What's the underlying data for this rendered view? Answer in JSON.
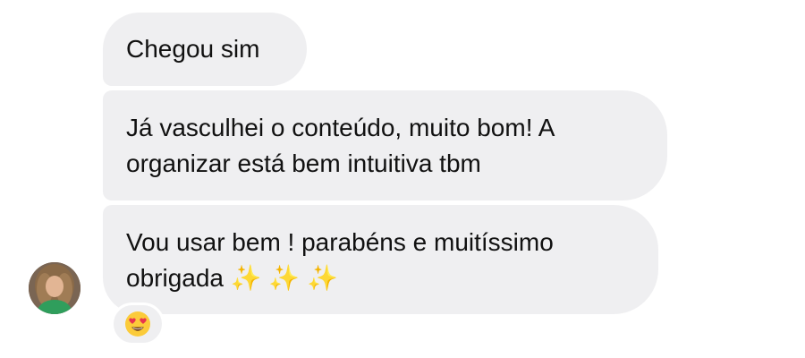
{
  "conversation": {
    "messages": [
      {
        "text": "Chegou sim"
      },
      {
        "text": "Já vasculhei o conteúdo, muito bom! A\norganizar está bem intuitiva tbm"
      },
      {
        "text": "Vou usar bem ! parabéns e muitíssimo\nobrigada ✨ ✨ ✨"
      }
    ],
    "reaction": {
      "icon": "heart-eyes-emoji-icon"
    },
    "avatar": {
      "icon": "contact-avatar"
    }
  },
  "colors": {
    "bubble_bg": "#efeff1",
    "text": "#111111",
    "background": "#ffffff"
  }
}
